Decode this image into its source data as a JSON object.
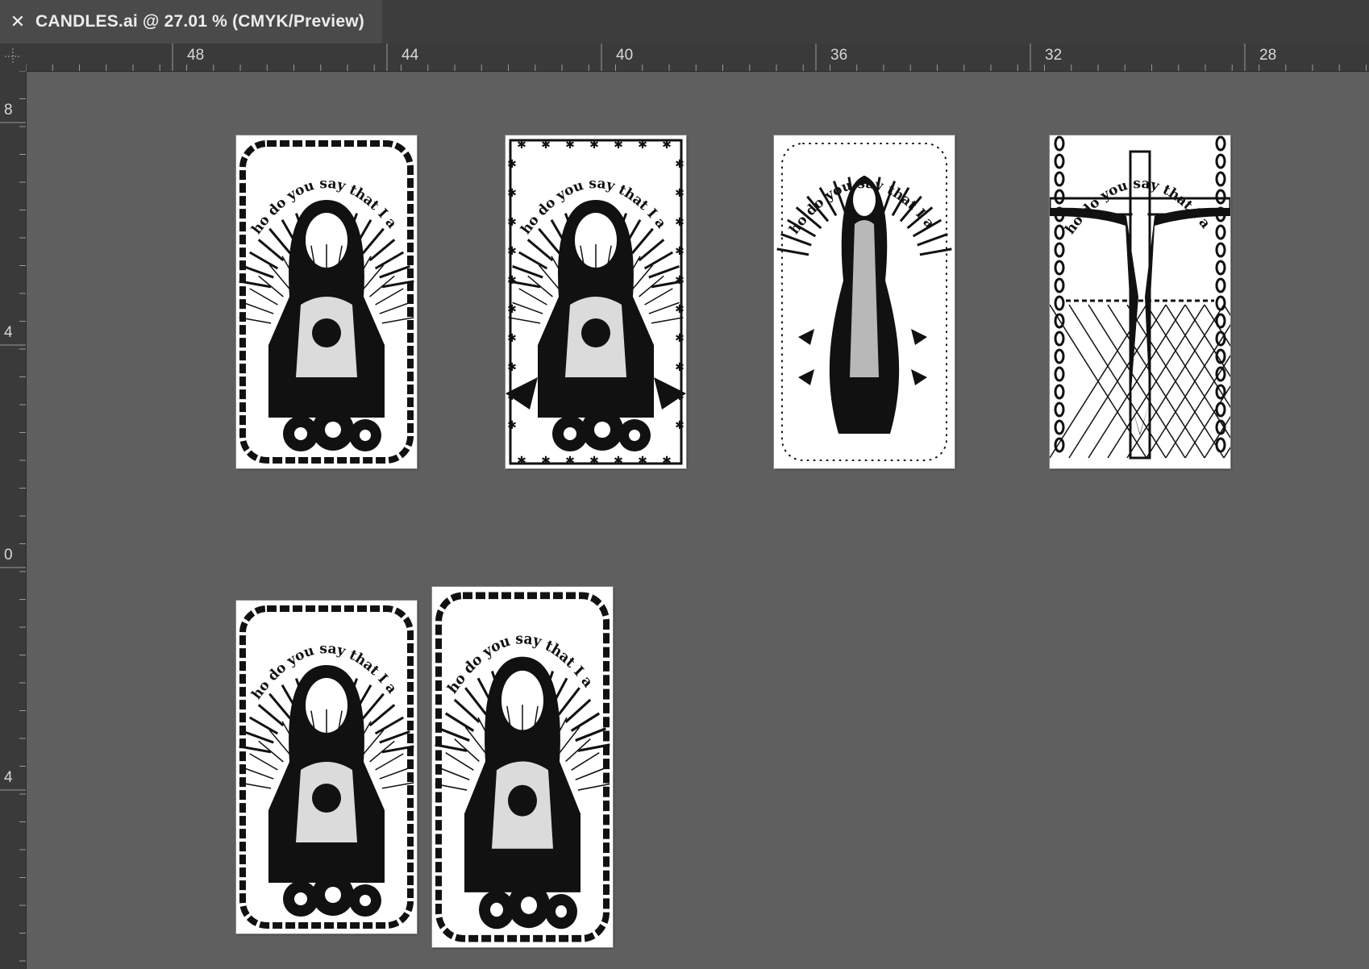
{
  "document": {
    "tab_title": "CANDLES.ai @ 27.01 % (CMYK/Preview)",
    "close_glyph": "✕"
  },
  "rulers": {
    "horizontal_labels": [
      "48",
      "44",
      "40",
      "36",
      "32",
      "28"
    ],
    "vertical_labels": [
      "8",
      "4",
      "0",
      "4"
    ]
  },
  "artboards": [
    {
      "design": "sacred-heart-jesus",
      "text": "Who do you say that I am?"
    },
    {
      "design": "immaculate-heart-mary",
      "text": "Who do you say that I am?"
    },
    {
      "design": "our-lady-guadalupe",
      "text": "Who do you say that I am?"
    },
    {
      "design": "crucifix",
      "text": "Who do you say that I am?"
    },
    {
      "design": "sacred-heart-jesus",
      "text": "Who do you say that I am?"
    },
    {
      "design": "sacred-heart-jesus",
      "text": "Who do you say that I am?"
    }
  ],
  "colors": {
    "canvas": "#5f5f5f",
    "ruler": "#3a3a3a",
    "tabbar": "#3d3d3d",
    "artboard": "#ffffff",
    "ink": "#111111"
  }
}
